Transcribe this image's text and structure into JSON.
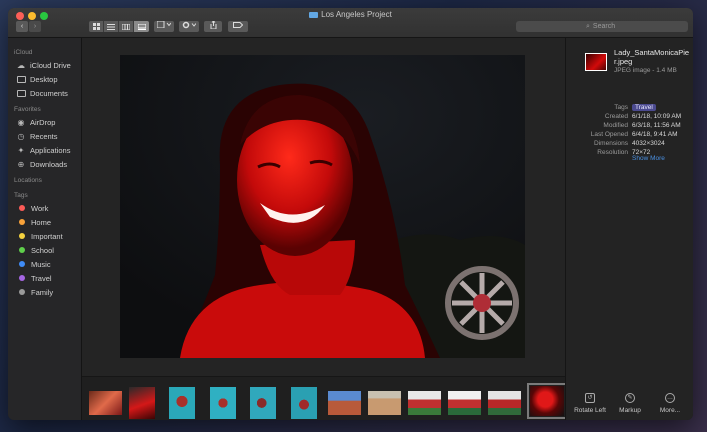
{
  "window": {
    "title": "Los Angeles Project"
  },
  "toolbar": {
    "back": "‹",
    "forward": "›",
    "search_placeholder": "Search"
  },
  "sidebar": {
    "icloud_header": "iCloud",
    "icloud": [
      {
        "label": "iCloud Drive",
        "icon": "cloud-icon"
      },
      {
        "label": "Desktop",
        "icon": "desktop-icon"
      },
      {
        "label": "Documents",
        "icon": "document-icon"
      }
    ],
    "favorites_header": "Favorites",
    "favorites": [
      {
        "label": "AirDrop",
        "icon": "airdrop-icon"
      },
      {
        "label": "Recents",
        "icon": "clock-icon"
      },
      {
        "label": "Applications",
        "icon": "applications-icon"
      },
      {
        "label": "Downloads",
        "icon": "download-icon"
      }
    ],
    "locations_header": "Locations",
    "tags_header": "Tags",
    "tags": [
      {
        "label": "Work",
        "color": "#fc5b57"
      },
      {
        "label": "Home",
        "color": "#f9a23a"
      },
      {
        "label": "Important",
        "color": "#f4d13f"
      },
      {
        "label": "School",
        "color": "#5fcf4b"
      },
      {
        "label": "Music",
        "color": "#3f8cf7"
      },
      {
        "label": "Travel",
        "color": "#a666e3"
      },
      {
        "label": "Family",
        "color": "#9a9a9a"
      }
    ]
  },
  "inspector": {
    "file_name": "Lady_SantaMonicaPier.jpeg",
    "file_kind": "JPEG image - 1.4 MB",
    "tags_label": "Tags",
    "tags_value": "Travel",
    "meta": [
      {
        "label": "Created",
        "value": "6/1/18, 10:09 AM"
      },
      {
        "label": "Modified",
        "value": "6/3/18, 11:56 AM"
      },
      {
        "label": "Last Opened",
        "value": "6/4/18, 9:41 AM"
      },
      {
        "label": "Dimensions",
        "value": "4032×3024"
      },
      {
        "label": "Resolution",
        "value": "72×72"
      }
    ],
    "show_more": "Show More",
    "actions": [
      {
        "label": "Rotate Left",
        "icon": "rotate-left-icon"
      },
      {
        "label": "Markup",
        "icon": "markup-icon"
      },
      {
        "label": "More...",
        "icon": "more-icon"
      }
    ]
  },
  "colors": {
    "accent": "#4a90e2",
    "photo_red": "#d20a0a"
  }
}
